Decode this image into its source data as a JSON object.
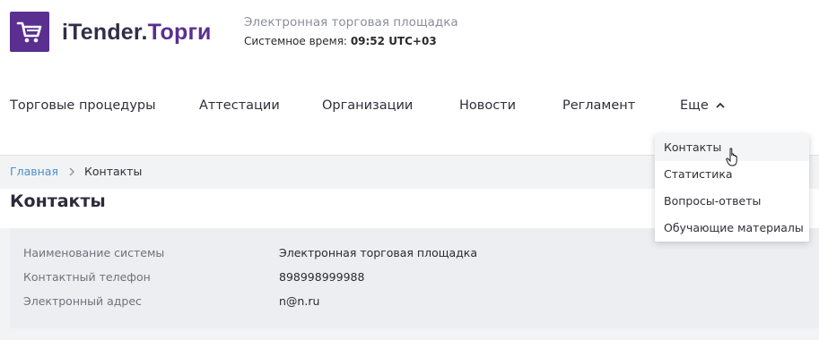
{
  "header": {
    "brand_part1": "iTender.",
    "brand_part2": "Торги",
    "tagline": "Электронная торговая площадка",
    "system_time_label": "Системное время:",
    "system_time_value": "09:52 UTC+03",
    "logo_icon": "cart-icon",
    "accent_color": "#5a2f8f"
  },
  "nav": {
    "items": [
      {
        "label": "Торговые процедуры"
      },
      {
        "label": "Аттестации"
      },
      {
        "label": "Организации"
      },
      {
        "label": "Новости"
      },
      {
        "label": "Регламент"
      },
      {
        "label": "Еще"
      }
    ],
    "more_icon": "chevron-up-icon"
  },
  "dropdown": {
    "items": [
      {
        "label": "Контакты"
      },
      {
        "label": "Статистика"
      },
      {
        "label": "Вопросы-ответы"
      },
      {
        "label": "Обучающие материалы"
      }
    ]
  },
  "breadcrumb": {
    "home": "Главная",
    "current": "Контакты",
    "separator_icon": "chevron-right-icon"
  },
  "page": {
    "title": "Контакты"
  },
  "contacts": {
    "rows": [
      {
        "label": "Наименование системы",
        "value": "Электронная торговая площадка"
      },
      {
        "label": "Контактный телефон",
        "value": "898998999988"
      },
      {
        "label": "Электронный адрес",
        "value": "n@n.ru"
      }
    ]
  }
}
